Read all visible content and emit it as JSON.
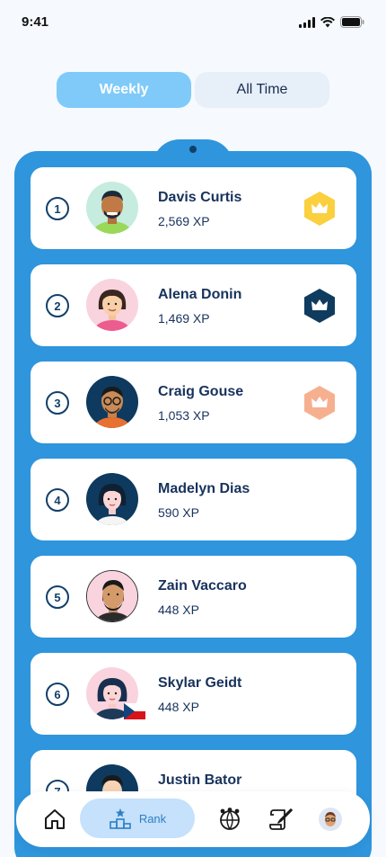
{
  "status": {
    "time": "9:41"
  },
  "tabs": [
    {
      "label": "Weekly",
      "active": true
    },
    {
      "label": "All Time",
      "active": false
    }
  ],
  "leaderboard": [
    {
      "rank": "1",
      "name": "Davis Curtis",
      "xp": "2,569 XP",
      "badge": "gold-crown",
      "badge_color": "#fbd03f"
    },
    {
      "rank": "2",
      "name": "Alena Donin",
      "xp": "1,469 XP",
      "badge": "navy-crown",
      "badge_color": "#0f3b5f"
    },
    {
      "rank": "3",
      "name": "Craig Gouse",
      "xp": "1,053 XP",
      "badge": "bronze-crown",
      "badge_color": "#f6b08f"
    },
    {
      "rank": "4",
      "name": "Madelyn Dias",
      "xp": "590 XP"
    },
    {
      "rank": "5",
      "name": "Zain Vaccaro",
      "xp": "448 XP"
    },
    {
      "rank": "6",
      "name": "Skylar Geidt",
      "xp": "448 XP",
      "flag": "czech-flag"
    },
    {
      "rank": "7",
      "name": "Justin Bator",
      "xp": ""
    }
  ],
  "nav": {
    "items": [
      "home-icon",
      "rank-icon",
      "globe-people-icon",
      "quill-scroll-icon",
      "profile-avatar"
    ],
    "active_label": "Rank"
  },
  "colors": {
    "board": "#2f95dc",
    "tab_active": "#7fcaf9",
    "tab_inactive": "#e7eff9",
    "text": "#17325c"
  }
}
